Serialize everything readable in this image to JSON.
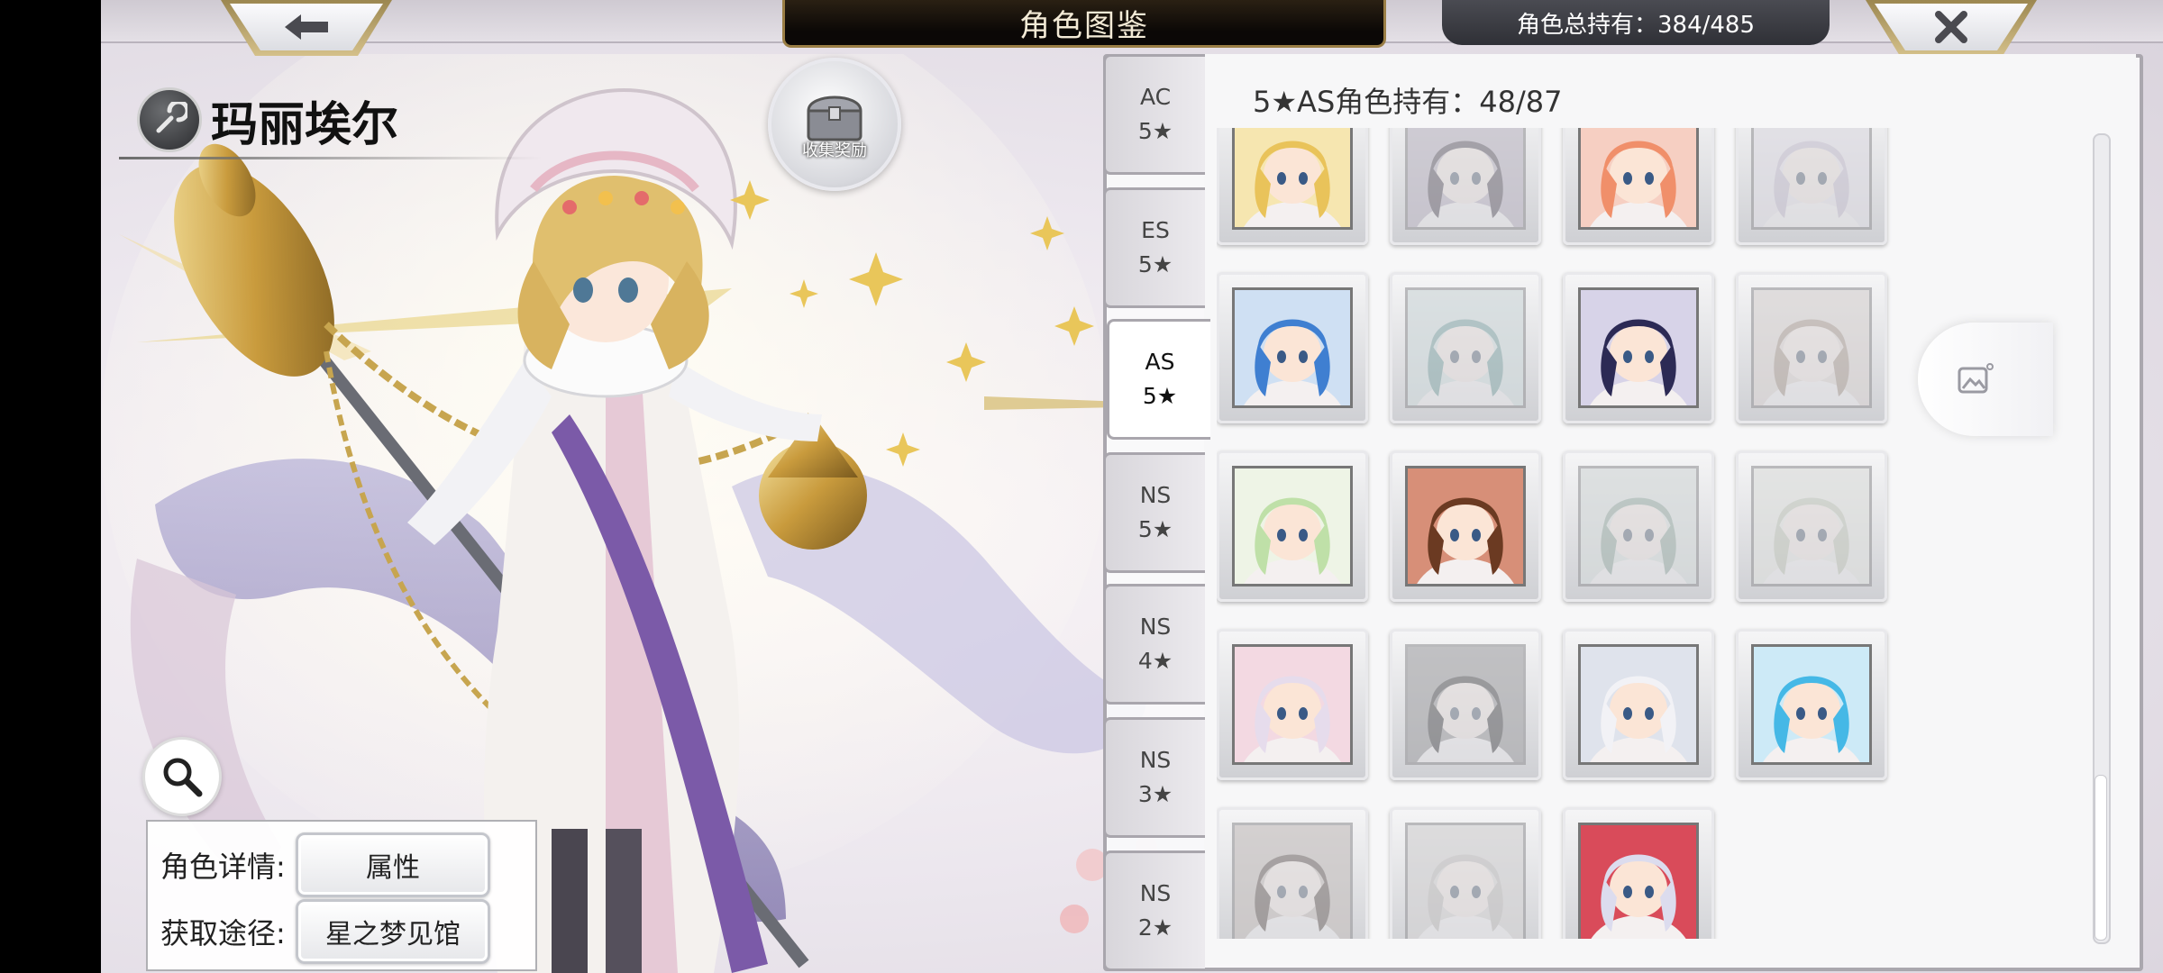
{
  "header": {
    "title": "角色图鉴",
    "total_owned": "角色总持有：384/485"
  },
  "character": {
    "name": "玛丽埃尔"
  },
  "collection_button": {
    "label": "收集奖励"
  },
  "details": {
    "detail_label": "角色详情:",
    "detail_button": "属性",
    "source_label": "获取途径:",
    "source_button": "星之梦见馆"
  },
  "tabs": [
    {
      "line1": "AC",
      "line2": "5★"
    },
    {
      "line1": "ES",
      "line2": "5★"
    },
    {
      "line1": "AS",
      "line2": "5★",
      "active": true
    },
    {
      "line1": "NS",
      "line2": "5★"
    },
    {
      "line1": "NS",
      "line2": "4★"
    },
    {
      "line1": "NS",
      "line2": "3★"
    },
    {
      "line1": "NS",
      "line2": "2★"
    }
  ],
  "list": {
    "header": "5★AS角色持有：48/87",
    "cards": [
      {
        "owned": true,
        "hair": "#e9c35a",
        "bg": "#f6e6b0"
      },
      {
        "owned": false,
        "hair": "#4b3a56",
        "bg": "#b8a7c9"
      },
      {
        "owned": true,
        "hair": "#f08f6a",
        "bg": "#f6cfc2"
      },
      {
        "owned": false,
        "hair": "#c9b6df",
        "bg": "#e8e1f1"
      },
      {
        "owned": true,
        "hair": "#3f7fd1",
        "bg": "#cfe0f3"
      },
      {
        "owned": false,
        "hair": "#3aa6a0",
        "bg": "#bfe3df"
      },
      {
        "owned": true,
        "hair": "#2c2a55",
        "bg": "#d7d3e8"
      },
      {
        "owned": false,
        "hair": "#b48c6a",
        "bg": "#e6d4c7"
      },
      {
        "owned": true,
        "hair": "#bfe0a8",
        "bg": "#eef4e6"
      },
      {
        "owned": true,
        "hair": "#6b3a22",
        "bg": "#d78f78"
      },
      {
        "owned": false,
        "hair": "#6ea98c",
        "bg": "#cfe2d8"
      },
      {
        "owned": false,
        "hair": "#b6c79a",
        "bg": "#e4ead8"
      },
      {
        "owned": true,
        "hair": "#e6dcec",
        "bg": "#f3d9e2"
      },
      {
        "owned": false,
        "hair": "#2a2a2a",
        "bg": "#8b8b8b"
      },
      {
        "owned": true,
        "hair": "#f2f2f6",
        "bg": "#dfe3ec"
      },
      {
        "owned": true,
        "hair": "#45b8e6",
        "bg": "#cdeaf7"
      },
      {
        "owned": false,
        "hair": "#5a3d2e",
        "bg": "#c7b3a4"
      },
      {
        "owned": false,
        "hair": "#bdb7ad",
        "bg": "#d6d2cc"
      },
      {
        "owned": true,
        "hair": "#dcdcee",
        "bg": "#d94b5a"
      }
    ]
  },
  "colors": {
    "gold": "#c9a860",
    "panel_border": "#aaa7ae",
    "title_plate": "#1a140c"
  },
  "icons": [
    "back-arrow-icon",
    "close-icon",
    "element-badge-icon",
    "treasure-chest-icon",
    "magnifier-icon",
    "gallery-image-icon"
  ]
}
